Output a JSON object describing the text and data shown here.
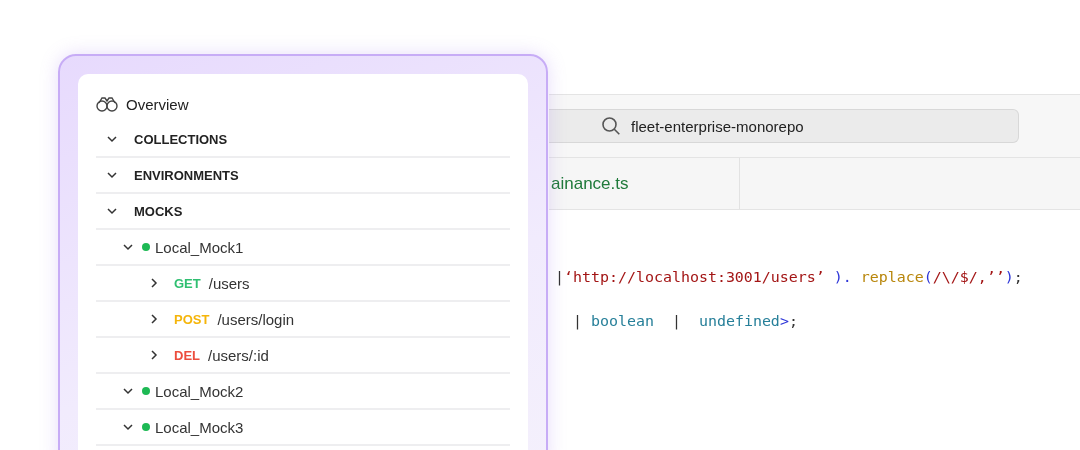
{
  "editor": {
    "search": {
      "value": "fleet-enterprise-monorepo"
    },
    "tabs": [
      {
        "label": "ainance.ts",
        "selected": true
      }
    ],
    "code_lines": [
      [
        {
          "t": "|",
          "color": "#333333"
        },
        {
          "t": "‘http://localhost:3001/users’",
          "color": "#a31515"
        },
        {
          "t": " ). ",
          "color": "#2d35d8"
        },
        {
          "t": "replace",
          "color": "#b8860b"
        },
        {
          "t": "(",
          "color": "#2d35d8"
        },
        {
          "t": "/\\/$/,’’",
          "color": "#a31515"
        },
        {
          "t": ")",
          "color": "#2d35d8"
        },
        {
          "t": ";",
          "color": "#333333"
        }
      ],
      [
        {
          "t": "|",
          "color": "#333333"
        },
        {
          "t": " boolean  ",
          "color": "#267f99"
        },
        {
          "t": "|",
          "color": "#333333"
        },
        {
          "t": "  undefined",
          "color": "#267f99"
        },
        {
          "t": ">",
          "color": "#2d35d8"
        },
        {
          "t": ";",
          "color": "#333333"
        }
      ]
    ]
  },
  "sidebar": {
    "overview": "Overview",
    "sections": [
      {
        "label": "COLLECTIONS",
        "expanded": true
      },
      {
        "label": "ENVIRONMENTS",
        "expanded": true
      },
      {
        "label": "MOCKS",
        "expanded": true,
        "children": [
          {
            "label": "Local_Mock1",
            "color": "#1db954",
            "expanded": true,
            "children": [
              {
                "method": "GET",
                "color": "#2fbf71",
                "path": "/users",
                "expanded": false
              },
              {
                "method": "POST",
                "color": "#f5b50a",
                "path": "/users/login",
                "expanded": false
              },
              {
                "method": "DEL",
                "color": "#ec4d3d",
                "path": "/users/:id",
                "expanded": false
              }
            ]
          },
          {
            "label": "Local_Mock2",
            "color": "#1db954",
            "expanded": true
          },
          {
            "label": "Local_Mock3",
            "color": "#1db954",
            "expanded": true
          }
        ]
      }
    ]
  }
}
